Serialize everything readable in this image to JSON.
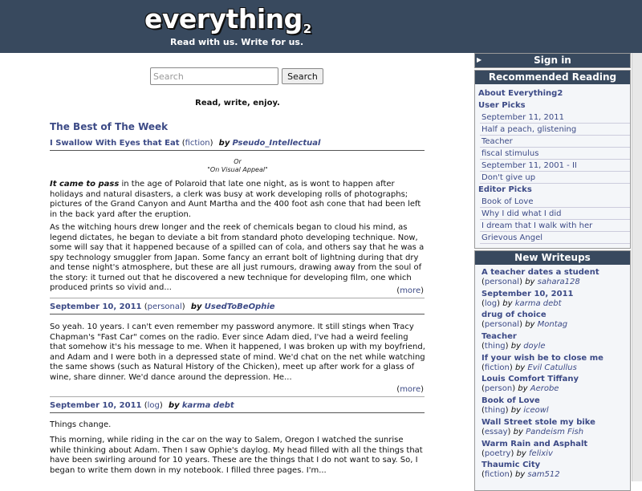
{
  "header": {
    "logo": "everything",
    "logo_suffix": "2",
    "tagline": "Read with us. Write for us."
  },
  "search": {
    "placeholder": "Search",
    "value": "",
    "button_label": "Search"
  },
  "slogan": "Read, write, enjoy.",
  "best_of_week": {
    "heading": "The Best of The Week",
    "entries": [
      {
        "title": "I Swallow With Eyes that Eat",
        "type": "fiction",
        "by": "by",
        "author": "Pseudo_Intellectual",
        "note_line1": "Or",
        "note_line2": "\"On Visual Appeal\"",
        "lead_bold": "It came to pass",
        "para1_rest": " in the age of Polaroid that late one night, as is wont to happen after holidays and natural disasters, a clerk was busy at work developing rolls of photographs; pictures of the Grand Canyon and Aunt Martha and the 400 foot ash cone that had been left in the back yard after the eruption.",
        "para2": "As the witching hours drew longer and the reek of chemicals began to cloud his mind, as legend dictates, he began to deviate a bit from standard photo developing technique. Now, some will say that it happened because of a spilled can of cola, and others say that he was a spy technology smuggler from Japan. Some fancy an errant bolt of lightning during that dry and tense night's atmosphere, but these are all just rumours, drawing away from the soul of the story: it turned out that he discovered a new technique for developing film, one which produced prints so vivid and...",
        "more": "more"
      },
      {
        "title": "September 10, 2011",
        "type": "personal",
        "by": "by",
        "author": "UsedToBeOphie",
        "para1": "So yeah. 10 years. I can't even remember my password anymore. It still stings when Tracy Chapman's \"Fast Car\" comes on the radio. Ever since Adam died, I've had a weird feeling that somehow it's his message to me. When it happened, I was broken up with my boyfriend, and Adam and I were both in a depressed state of mind. We'd chat on the net while watching the same shows (such as Natural History of the Chicken), meet up after work for a glass of wine, share dinner. We'd dance around the depression. He...",
        "more": "more"
      },
      {
        "title": "September 10, 2011",
        "type": "log",
        "by": "by",
        "author": "karma debt",
        "para1": "Things change.",
        "para2": "This morning, while riding in the car on the way to Salem, Oregon I watched the sunrise while thinking about Adam. Then I saw Ophie's daylog. My head filled with all the things that have been swirling around for 10 years. These are the things that I do not want to say. So, I began to write them down in my notebook. I filled three pages. I'm..."
      }
    ]
  },
  "sidebar": {
    "sign_in": "Sign in",
    "recommended": {
      "header": "Recommended Reading",
      "about": "About Everything2",
      "user_picks_label": "User Picks",
      "user_picks": [
        "September 11, 2011",
        "Half a peach, glistening",
        "Teacher",
        "fiscal stimulus",
        "September 11, 2001 - II",
        "Don't give up"
      ],
      "editor_picks_label": "Editor Picks",
      "editor_picks": [
        "Book of Love",
        "Why I did what I did",
        "I dream that I walk with her",
        "Grievous Angel"
      ]
    },
    "new_writeups": {
      "header": "New Writeups",
      "by": "by",
      "items": [
        {
          "title": "A teacher dates a student",
          "type": "personal",
          "author": "sahara128"
        },
        {
          "title": "September 10, 2011",
          "type": "log",
          "author": "karma debt"
        },
        {
          "title": "drug of choice",
          "type": "personal",
          "author": "Montag"
        },
        {
          "title": "Teacher",
          "type": "thing",
          "author": "doyle"
        },
        {
          "title": "If your wish be to close me",
          "type": "fiction",
          "author": "Evil Catullus"
        },
        {
          "title": "Louis Comfort Tiffany",
          "type": "person",
          "author": "Aerobe"
        },
        {
          "title": "Book of Love",
          "type": "thing",
          "author": "iceowl"
        },
        {
          "title": "Wall Street stole my bike",
          "type": "essay",
          "author": "Pandeism Fish"
        },
        {
          "title": "Warm Rain and Asphalt",
          "type": "poetry",
          "author": "felixiv"
        },
        {
          "title": "Thaumic City",
          "type": "fiction",
          "author": "sam512"
        }
      ]
    }
  },
  "colors": {
    "header_bg": "#38495e",
    "link": "#3c4a86",
    "sidebar_bg": "#f4f6f9"
  }
}
